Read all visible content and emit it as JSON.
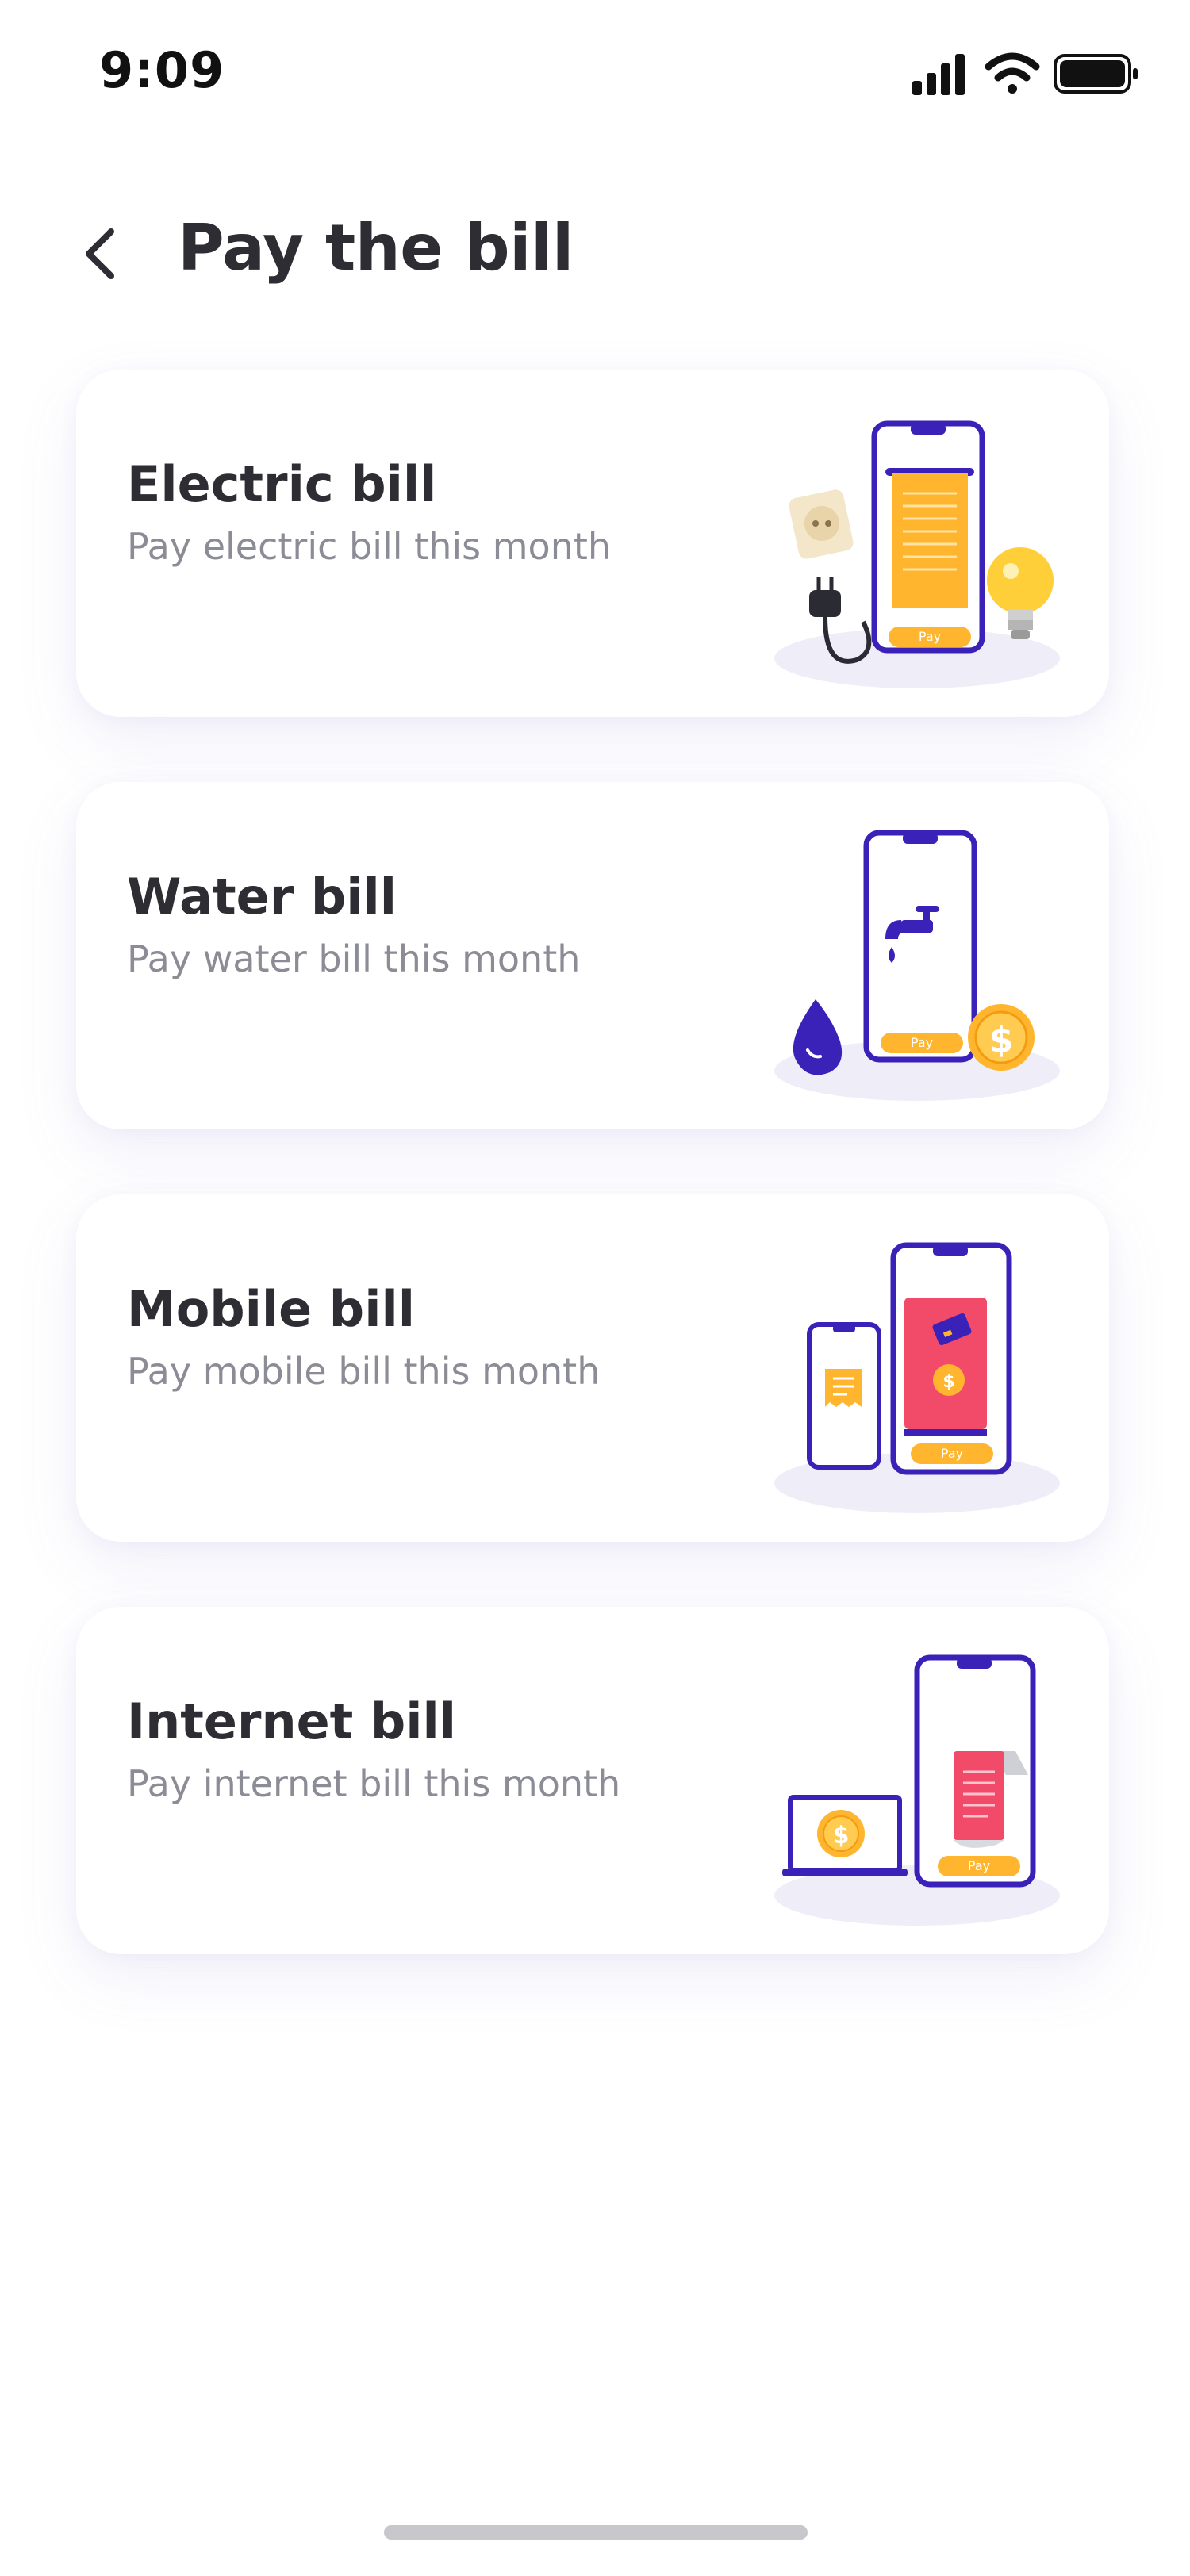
{
  "status_bar": {
    "time": "9:09",
    "icons": [
      "signal-icon",
      "wifi-icon",
      "battery-icon"
    ]
  },
  "header": {
    "back_icon": "chevron-left-icon",
    "title": "Pay the bill"
  },
  "bills": [
    {
      "title": "Electric bill",
      "subtitle": "Pay electric bill this month",
      "illustration": "electric-bill-illustration",
      "pay_label": "Pay"
    },
    {
      "title": "Water bill",
      "subtitle": "Pay water bill this month",
      "illustration": "water-bill-illustration",
      "pay_label": "Pay"
    },
    {
      "title": "Mobile bill",
      "subtitle": "Pay mobile bill this month",
      "illustration": "mobile-bill-illustration",
      "pay_label": "Pay"
    },
    {
      "title": "Internet bill",
      "subtitle": "Pay internet bill this month",
      "illustration": "internet-bill-illustration",
      "pay_label": "Pay"
    }
  ],
  "colors": {
    "accent": "#3a22b8",
    "highlight": "#ffb62e",
    "receipt_red": "#f24b6a",
    "title_text": "#2d2d33",
    "subtitle_text": "#8c8c96"
  }
}
